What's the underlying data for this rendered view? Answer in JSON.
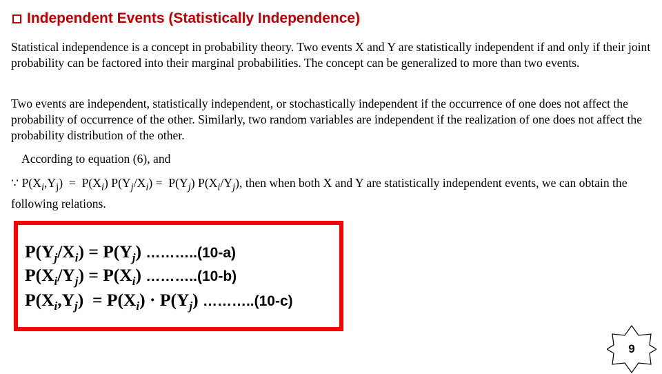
{
  "title": "Independent Events (Statistically Independence)",
  "paragraphs": {
    "p1": "Statistical independence is a concept in probability theory. Two events X and Y are statistically independent if and only if their joint probability can be factored  into their marginal probabilities. The concept can be generalized to more than two  events.",
    "p2": "Two events are independent, statistically independent, or stochastically independent if the occurrence of one does not affect the probability of occurrence of the other. Similarly, two random variables are independent if the realization of one does not affect the probability distribution of the other.",
    "p3": "According to equation (6), and",
    "p4_tail": ", then when both X and Y are statistically independent events, we can obtain the following relations."
  },
  "equations": {
    "eq1_tag": "………..(10-a)",
    "eq2_tag": "………..(10-b)",
    "eq3_tag": "………..(10-c)"
  },
  "page_number": "9",
  "colors": {
    "accent": "#c00000",
    "box_border": "#ff0000"
  }
}
